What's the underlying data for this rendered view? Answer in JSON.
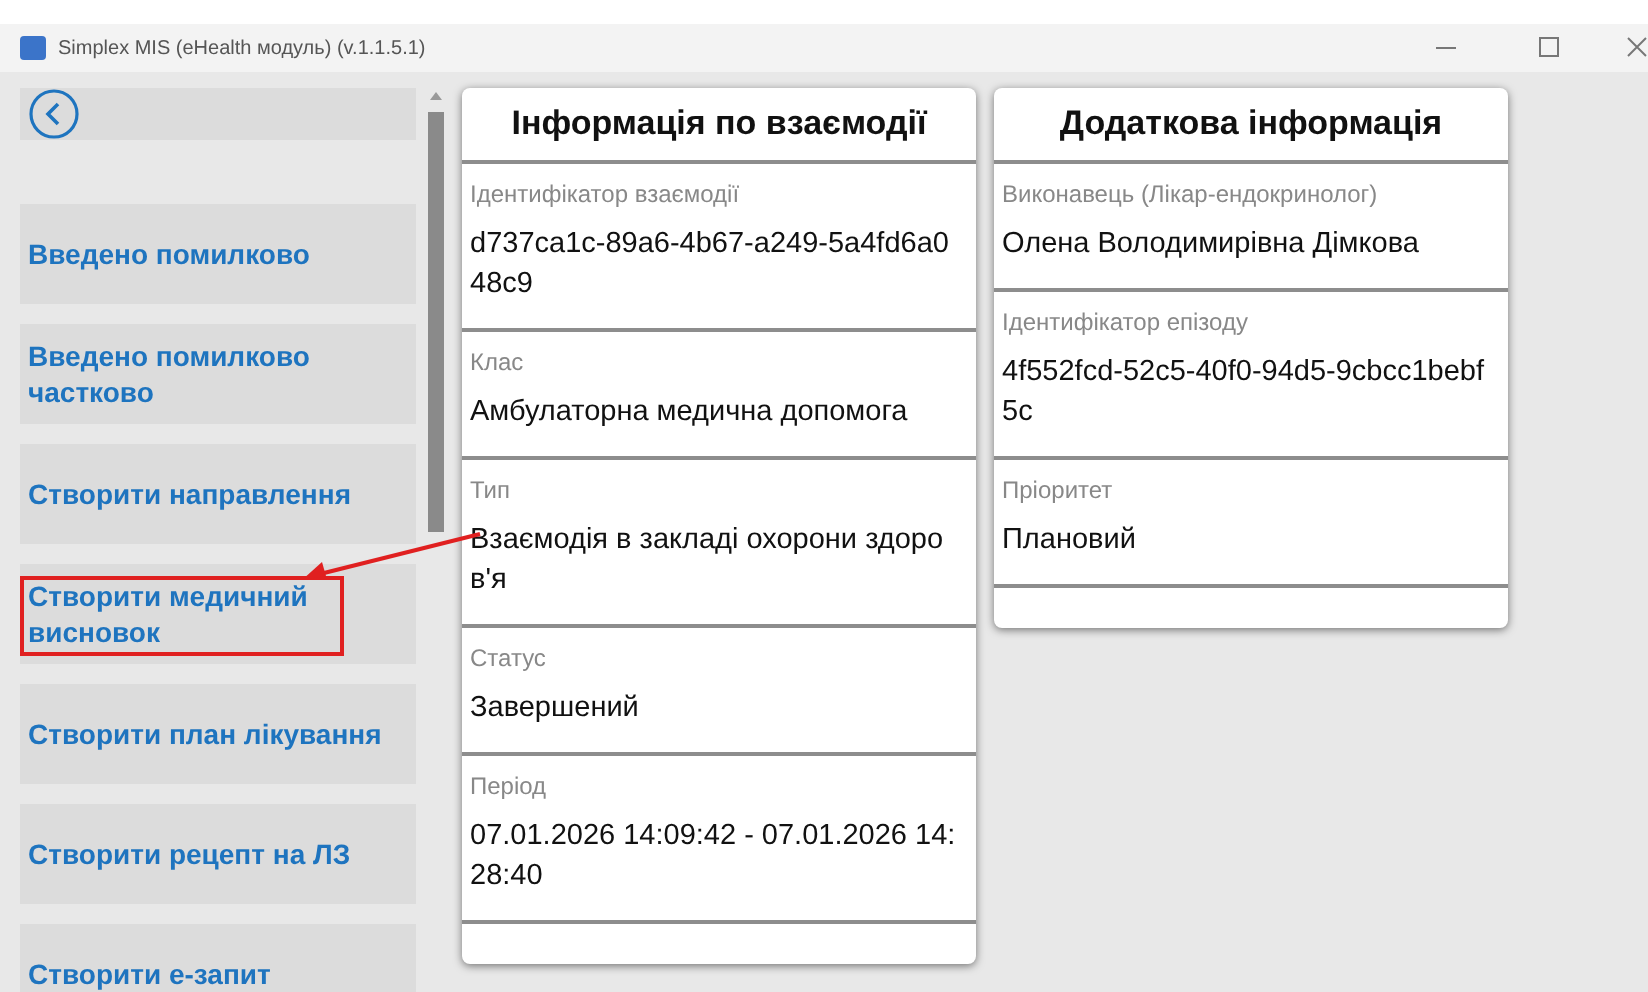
{
  "window": {
    "title": "Simplex MIS (eHealth модуль) (v.1.1.5.1)"
  },
  "sidebar": {
    "items": [
      {
        "label": "Введено помилково",
        "highlighted": false
      },
      {
        "label": "Введено помилково частково",
        "highlighted": false
      },
      {
        "label": "Створити направлення",
        "highlighted": false
      },
      {
        "label": "Створити медичний висновок",
        "highlighted": true
      },
      {
        "label": "Створити план лікування",
        "highlighted": false
      },
      {
        "label": "Створити рецепт на ЛЗ",
        "highlighted": false
      },
      {
        "label": "Створити е-запит",
        "highlighted": false
      }
    ]
  },
  "cards": [
    {
      "title": "Інформація по взаємодії",
      "fields": [
        {
          "label": "Ідентифікатор взаємодії",
          "value": "d737ca1c-89a6-4b67-a249-5a4fd6a048c9"
        },
        {
          "label": "Клас",
          "value": "Амбулаторна медична допомога"
        },
        {
          "label": "Тип",
          "value": "Взаємодія в закладі охорони здоров'я"
        },
        {
          "label": "Статус",
          "value": "Завершений"
        },
        {
          "label": "Період",
          "value": "07.01.2026 14:09:42 - 07.01.2026 14:28:40"
        }
      ]
    },
    {
      "title": "Додаткова інформація",
      "fields": [
        {
          "label": "Виконавець (Лікар-ендокринолог)",
          "value": "Олена Володимирівна Дімкова"
        },
        {
          "label": "Ідентифікатор епізоду",
          "value": "4f552fcd-52c5-40f0-94d5-9cbcc1bebf5c"
        },
        {
          "label": "Пріоритет",
          "value": "Плановий"
        }
      ]
    }
  ]
}
